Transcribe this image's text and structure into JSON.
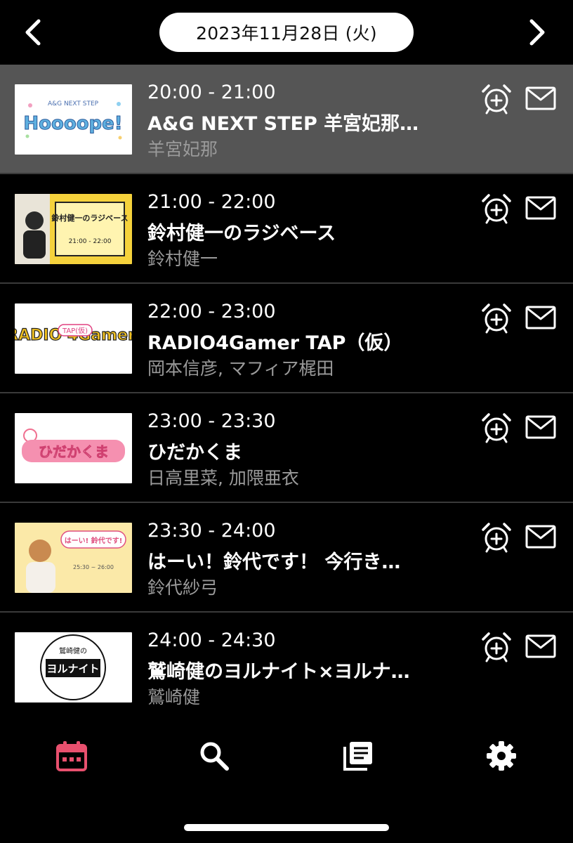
{
  "header": {
    "date": "2023年11月28日 (火)",
    "prev_icon": "chevron-left-icon",
    "next_icon": "chevron-right-icon"
  },
  "programs": [
    {
      "time": "20:00 - 21:00",
      "title": "A&G NEXT STEP 羊宮妃那…",
      "cast": "羊宮妃那",
      "thumb_text": "Hoooope!",
      "thumb_subtext": "A&G NEXT STEP",
      "selected": true
    },
    {
      "time": "21:00 - 22:00",
      "title": "鈴村健一のラジベース",
      "cast": "鈴村健一",
      "thumb_text": "鈴村健一のラジベース",
      "thumb_subtext": "21:00 - 22:00"
    },
    {
      "time": "22:00 - 23:00",
      "title": "RADIO4Gamer TAP（仮）",
      "cast": "岡本信彦, マフィア梶田",
      "thumb_text": "RADIO 4Gamer",
      "thumb_subtext": "TAP(仮)"
    },
    {
      "time": "23:00 - 23:30",
      "title": "ひだかくま",
      "cast": "日高里菜, 加隈亜衣",
      "thumb_text": "ひだかくま",
      "thumb_subtext": ""
    },
    {
      "time": "23:30 - 24:00",
      "title": "はーい！鈴代です！ 今行き…",
      "cast": "鈴代紗弓",
      "thumb_text": "はーい! 鈴代です!",
      "thumb_subtext": "25:30 ~ 26:00"
    },
    {
      "time": "24:00 - 24:30",
      "title": "鷲崎健のヨルナイト×ヨルナ…",
      "cast": "鷲崎健",
      "thumb_text": "ヨルナイト",
      "thumb_subtext": "鷲崎健の"
    }
  ],
  "row_icons": {
    "alarm": "alarm-add-icon",
    "mail": "mail-icon"
  },
  "tabs": [
    {
      "name": "calendar",
      "icon": "calendar-icon",
      "active": true
    },
    {
      "name": "search",
      "icon": "search-icon",
      "active": false
    },
    {
      "name": "library",
      "icon": "library-icon",
      "active": false
    },
    {
      "name": "settings",
      "icon": "gear-icon",
      "active": false
    }
  ],
  "colors": {
    "background": "#000000",
    "selected_row": "#555555",
    "active_tab": "#e8506e",
    "inactive_tab": "#ffffff",
    "cast_text": "#9a9a9a"
  }
}
